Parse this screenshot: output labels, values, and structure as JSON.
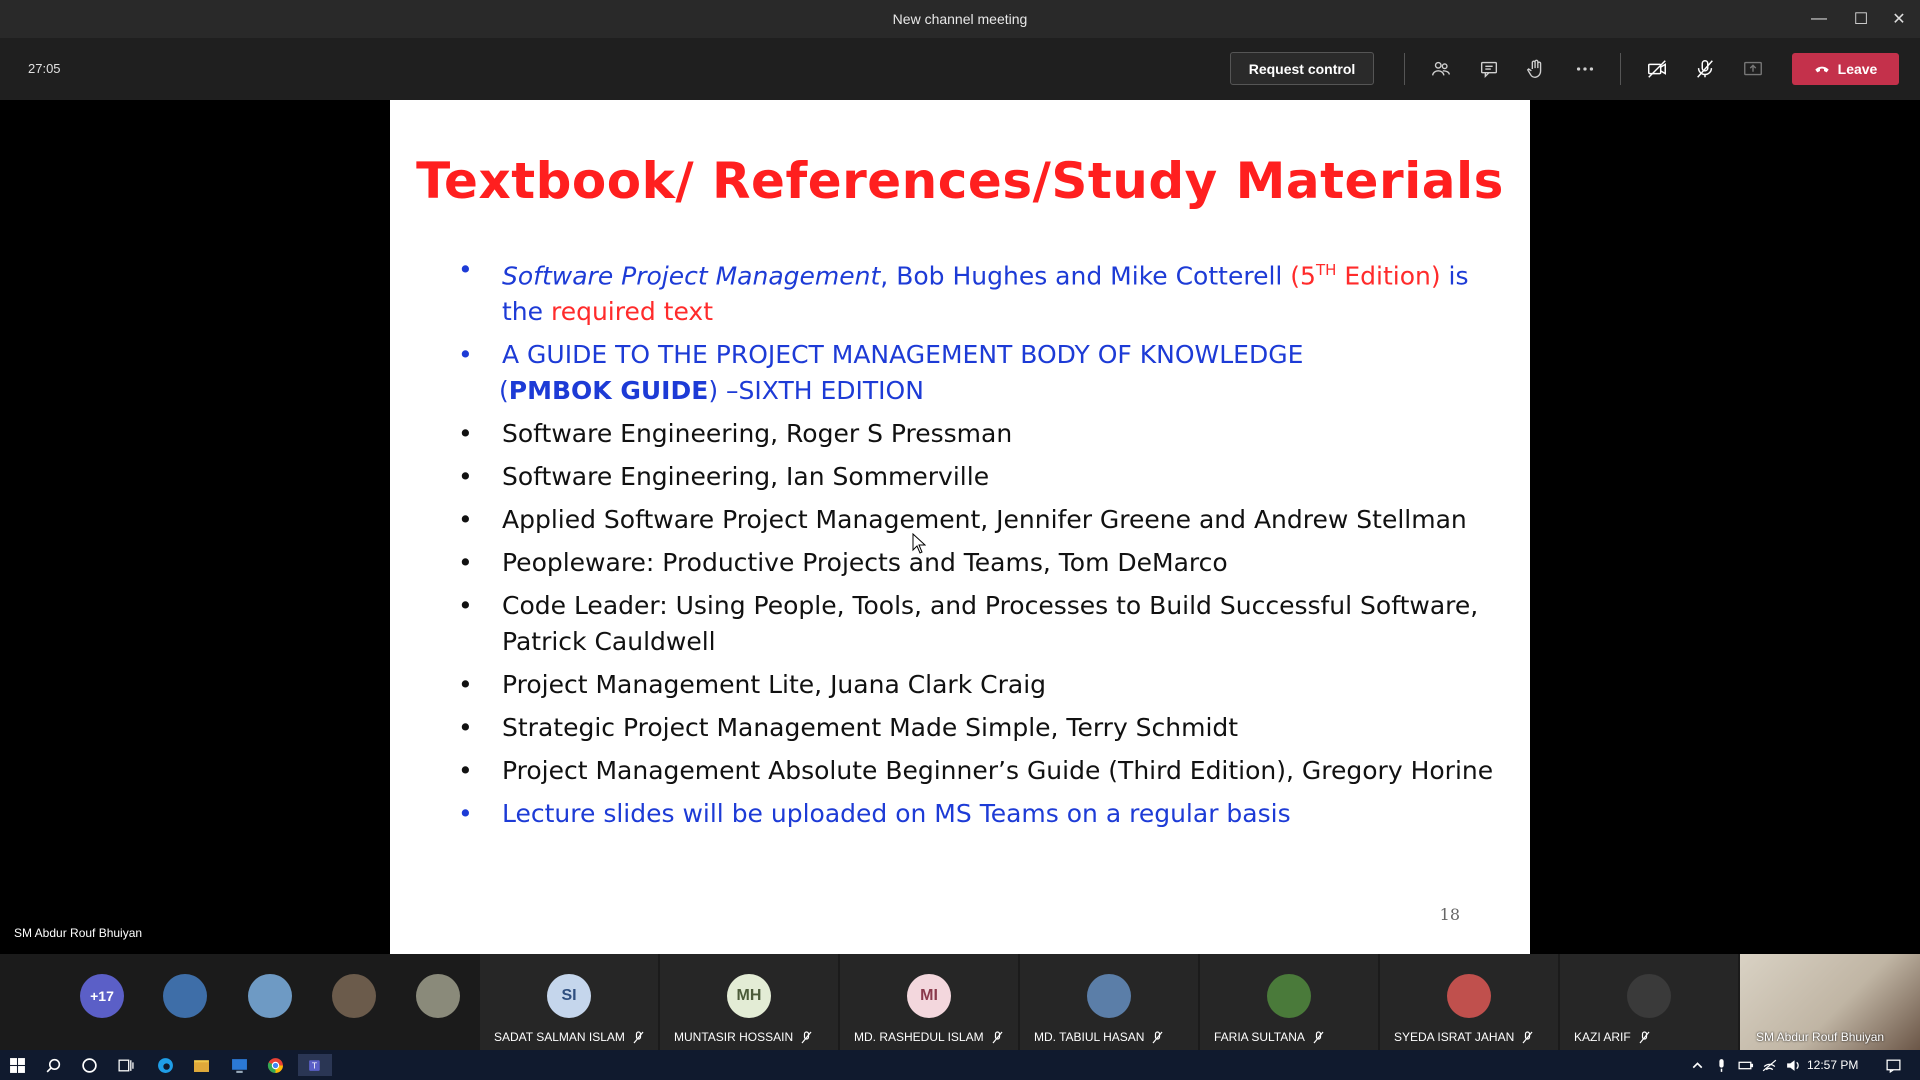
{
  "window": {
    "title": "New channel meeting",
    "minimize": "—",
    "maximize": "☐",
    "close": "✕"
  },
  "toolbar": {
    "timer": "27:05",
    "request_control": "Request control",
    "leave": "Leave",
    "icons": [
      "participants-icon",
      "chat-icon",
      "raise-hand-icon",
      "more-icon",
      "camera-off-icon",
      "mic-off-icon",
      "share-tray-icon"
    ]
  },
  "slide": {
    "title": "Textbook/ References/Study Materials",
    "items": [
      {
        "part1": "Software Project Management",
        "part2": ", ",
        "part3": "Bob Hughes",
        "part4": " and ",
        "part5": "Mike Cotterell",
        "part6": " (5",
        "part7": "TH",
        "part8": " Edition)",
        "part9": " is the ",
        "part10": "required text"
      },
      {
        "line1": "A GUIDE TO THE PROJECT MANAGEMENT BODY OF KNOWLEDGE",
        "open": "(",
        "bold": "PMBOK GUIDE",
        "rest": ") –SIXTH EDITION"
      },
      {
        "text": "Software Engineering,  Roger S Pressman"
      },
      {
        "text": "Software Engineering,  Ian Sommerville"
      },
      {
        "text": "Applied Software Project Management, Jennifer Greene and Andrew Stellman"
      },
      {
        "text": "Peopleware: Productive Projects and Teams, Tom DeMarco"
      },
      {
        "text": "Code Leader: Using People, Tools, and Processes to Build Successful Software, Patrick Cauldwell"
      },
      {
        "text": "Project Management Lite, Juana Clark Craig"
      },
      {
        "text": "Strategic Project Management Made Simple, Terry Schmidt"
      },
      {
        "text": "Project Management Absolute Beginner’s Guide (Third Edition), Gregory Horine"
      },
      {
        "text": "Lecture slides will be uploaded on MS Teams on a regular basis"
      }
    ],
    "page_number": "18",
    "presenter": "SM Abdur Rouf Bhuiyan"
  },
  "participants": {
    "more_count": "+17",
    "tiles": [
      {
        "initials": "SI",
        "name": "SADAT SALMAN ISLAM",
        "bg": "#c5d6ec",
        "fg": "#2f4f7f"
      },
      {
        "initials": "MH",
        "name": "MUNTASIR HOSSAIN",
        "bg": "#e3ecd5",
        "fg": "#4c5b3a"
      },
      {
        "initials": "MI",
        "name": "MD. RASHEDUL ISLAM",
        "bg": "#f3d7dd",
        "fg": "#8a3a4c"
      },
      {
        "initials": "",
        "name": "MD. TABIUL HASAN",
        "bg": "#5b7ea8",
        "fg": "#fff"
      },
      {
        "initials": "",
        "name": "FARIA SULTANA",
        "bg": "#4a7a3a",
        "fg": "#fff"
      },
      {
        "initials": "",
        "name": "SYEDA ISRAT JAHAN",
        "bg": "#c0504d",
        "fg": "#fff"
      },
      {
        "initials": "",
        "name": "KAZI ARIF",
        "bg": "#3a3a3a",
        "fg": "#fff"
      }
    ],
    "self_view_name": "SM Abdur Rouf Bhuiyan"
  },
  "taskbar": {
    "time": "12:57 PM"
  },
  "colors": {
    "leave": "#c4314b",
    "accent": "#5b5fc7",
    "slide_title": "#ff1f1f",
    "slide_blue": "#1d3bd6"
  }
}
